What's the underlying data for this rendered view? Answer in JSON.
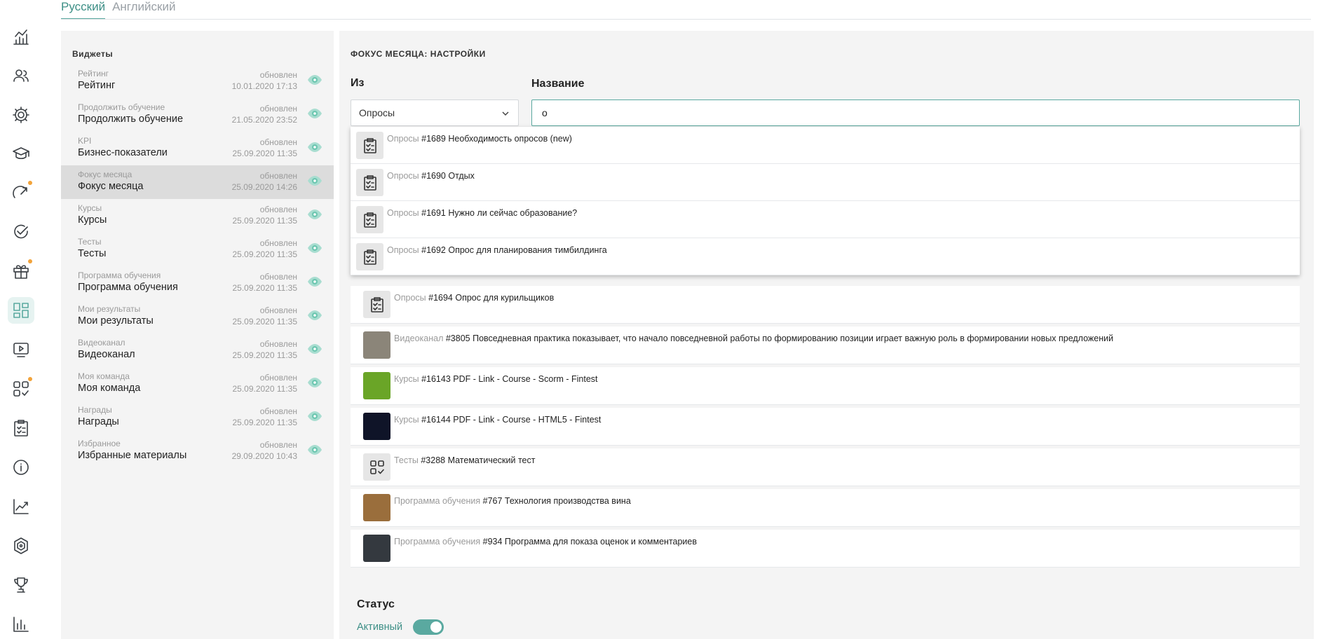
{
  "lang_tabs": [
    {
      "label": "Русский",
      "active": true
    },
    {
      "label": "Английский",
      "active": false
    }
  ],
  "sidebar_icons": [
    "analytics-icon",
    "users-icon",
    "gear-icon",
    "graduation-cap-icon",
    "gauge-icon",
    "check-circle-icon",
    "gift-icon",
    "widgets-icon",
    "video-icon",
    "apps-check-icon",
    "clipboard-icon",
    "info-icon",
    "trend-icon",
    "hexagon-icon",
    "trophy-icon",
    "bar-chart-icon"
  ],
  "widgets": {
    "title": "Виджеты",
    "items": [
      {
        "type": "Рейтинг",
        "name": "Рейтинг",
        "updated": "обновлен",
        "date": "10.01.2020 17:13"
      },
      {
        "type": "Продолжить обучение",
        "name": "Продолжить обучение",
        "updated": "обновлен",
        "date": "21.05.2020 23:52"
      },
      {
        "type": "KPI",
        "name": "Бизнес-показатели",
        "updated": "обновлен",
        "date": "25.09.2020 11:35"
      },
      {
        "type": "Фокус месяца",
        "name": "Фокус месяца",
        "updated": "обновлен",
        "date": "25.09.2020 14:26"
      },
      {
        "type": "Курсы",
        "name": "Курсы",
        "updated": "обновлен",
        "date": "25.09.2020 11:35"
      },
      {
        "type": "Тесты",
        "name": "Тесты",
        "updated": "обновлен",
        "date": "25.09.2020 11:35"
      },
      {
        "type": "Программа обучения",
        "name": "Программа обучения",
        "updated": "обновлен",
        "date": "25.09.2020 11:35"
      },
      {
        "type": "Мои результаты",
        "name": "Мои результаты",
        "updated": "обновлен",
        "date": "25.09.2020 11:35"
      },
      {
        "type": "Видеоканал",
        "name": "Видеоканал",
        "updated": "обновлен",
        "date": "25.09.2020 11:35"
      },
      {
        "type": "Моя команда",
        "name": "Моя команда",
        "updated": "обновлен",
        "date": "25.09.2020 11:35"
      },
      {
        "type": "Награды",
        "name": "Награды",
        "updated": "обновлен",
        "date": "25.09.2020 11:35"
      },
      {
        "type": "Избранное",
        "name": "Избранные материалы",
        "updated": "обновлен",
        "date": "29.09.2020 10:43"
      }
    ]
  },
  "settings": {
    "title": "ФОКУС МЕСЯЦА: НАСТРОЙКИ",
    "from_label": "Из",
    "from_value": "Опросы",
    "name_label": "Название",
    "name_value": "о"
  },
  "dropdown": [
    {
      "category": "Опросы",
      "text": "#1689 Необходимость опросов (new)"
    },
    {
      "category": "Опросы",
      "text": "#1690 Отдых"
    },
    {
      "category": "Опросы",
      "text": "#1691 Нужно ли сейчас образование?"
    },
    {
      "category": "Опросы",
      "text": "#1692 Опрос для планирования тимбилдинга"
    }
  ],
  "results": [
    {
      "category": "Опросы",
      "text": "#1694 Опрос для курильщиков",
      "thumb": "clipboard-icon"
    },
    {
      "category": "Видеоканал",
      "text": "#3805 Повседневная практика показывает, что начало повседневной работы по формированию позиции играет важную роль в формировании новых предложений",
      "thumb": "photo",
      "color": "#8b8579"
    },
    {
      "category": "Курсы",
      "text": "#16143 PDF - Link - Course - Scorm - Fintest",
      "thumb": "photo",
      "color": "#6aa527"
    },
    {
      "category": "Курсы",
      "text": "#16144 PDF - Link - Course - HTML5 - Fintest",
      "thumb": "photo",
      "color": "#0f1428"
    },
    {
      "category": "Тесты",
      "text": "#3288 Математический тест",
      "thumb": "apps-check-icon"
    },
    {
      "category": "Программа обучения",
      "text": "#767 Технология производства вина",
      "thumb": "photo",
      "color": "#9a6e3c"
    },
    {
      "category": "Программа обучения",
      "text": "#934 Программа для показа оценок и комментариев",
      "thumb": "photo",
      "color": "#34393f"
    }
  ],
  "status": {
    "title": "Статус",
    "label": "Активный",
    "on": true
  },
  "colors": {
    "accent": "#5aa9a0",
    "badge": "#f2a33a",
    "panel": "#f4f4f4"
  }
}
